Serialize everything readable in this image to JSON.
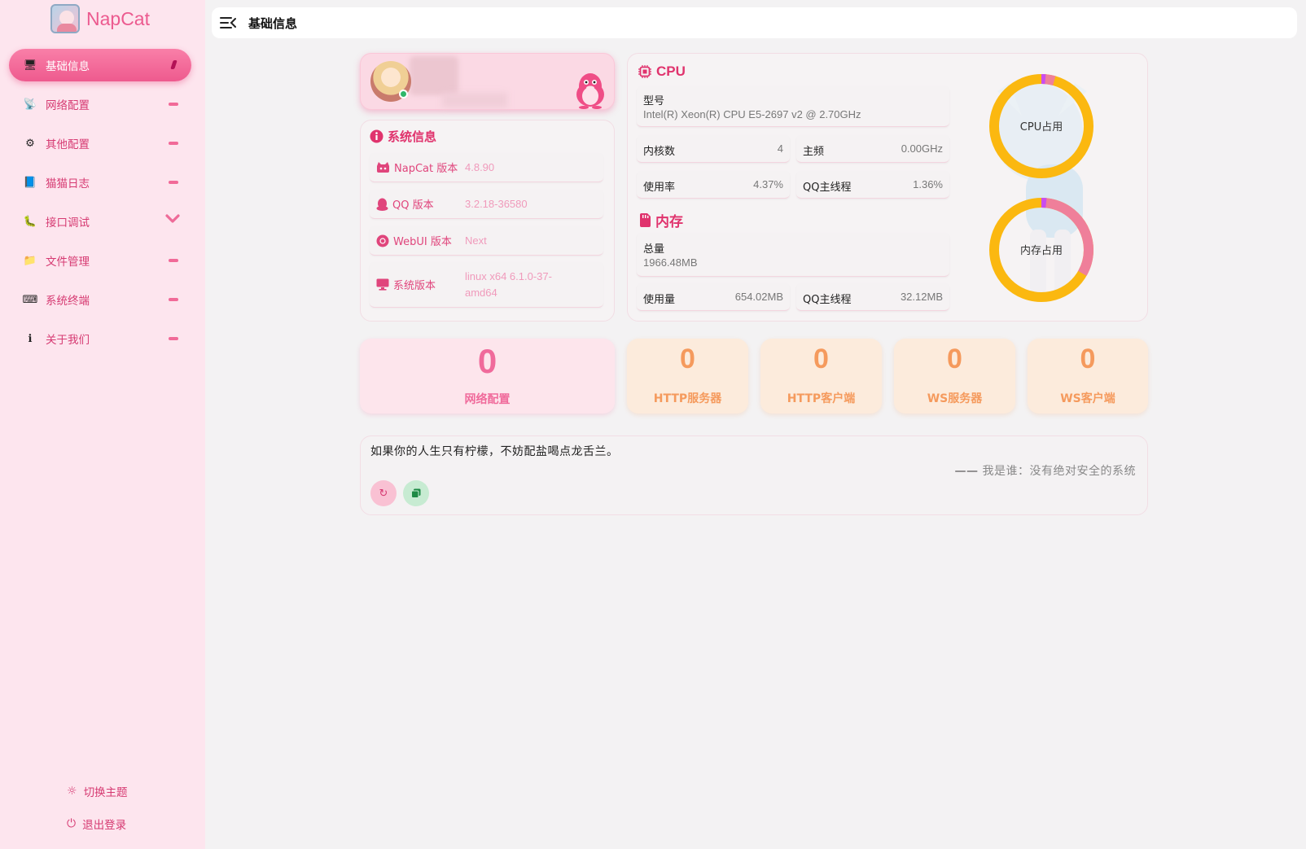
{
  "brand": {
    "name": "NapCat"
  },
  "sidebar": {
    "items": [
      {
        "label": "基础信息",
        "icon": "dashboard-icon",
        "glyph": "🖥",
        "active": true
      },
      {
        "label": "网络配置",
        "icon": "antenna-icon",
        "glyph": "📡"
      },
      {
        "label": "其他配置",
        "icon": "gear-icon",
        "glyph": "⚙"
      },
      {
        "label": "猫猫日志",
        "icon": "notebook-icon",
        "glyph": "📘"
      },
      {
        "label": "接口调试",
        "icon": "bug-icon",
        "glyph": "🐛",
        "expandable": true
      },
      {
        "label": "文件管理",
        "icon": "folder-icon",
        "glyph": "📁"
      },
      {
        "label": "系统终端",
        "icon": "terminal-icon",
        "glyph": "⌨"
      },
      {
        "label": "关于我们",
        "icon": "info-icon",
        "glyph": "ℹ"
      }
    ],
    "theme_label": "切换主题",
    "logout_label": "退出登录"
  },
  "header": {
    "title": "基础信息"
  },
  "system_info": {
    "title": "系统信息",
    "rows": [
      {
        "label": "NapCat 版本",
        "value": "4.8.90",
        "icon": "napcat-icon"
      },
      {
        "label": "QQ 版本",
        "value": "3.2.18-36580",
        "icon": "qq-icon"
      },
      {
        "label": "WebUI 版本",
        "value": "Next",
        "icon": "chrome-icon"
      },
      {
        "label": "系统版本",
        "value": "linux x64 6.1.0-37-amd64",
        "icon": "monitor-icon"
      }
    ]
  },
  "cpu": {
    "title": "CPU",
    "model_label": "型号",
    "model_value": "Intel(R) Xeon(R) CPU E5-2697 v2 @ 2.70GHz",
    "cores_label": "内核数",
    "cores_value": "4",
    "freq_label": "主频",
    "freq_value": "0.00GHz",
    "usage_label": "使用率",
    "usage_value": "4.37%",
    "qq_thread_label": "QQ主线程",
    "qq_thread_value": "1.36%",
    "gauge_label": "CPU占用",
    "usage_fraction": 0.0437,
    "qq_fraction": 0.0136
  },
  "memory": {
    "title": "内存",
    "total_label": "总量",
    "total_value": "1966.48MB",
    "used_label": "使用量",
    "used_value": "654.02MB",
    "qq_thread_label": "QQ主线程",
    "qq_thread_value": "32.12MB",
    "gauge_label": "内存占用",
    "usage_fraction": 0.3326,
    "qq_fraction": 0.0163
  },
  "counters": [
    {
      "value": "0",
      "label": "网络配置",
      "style": "pink"
    },
    {
      "value": "0",
      "label": "HTTP服务器",
      "style": "orange"
    },
    {
      "value": "0",
      "label": "HTTP客户端",
      "style": "orange"
    },
    {
      "value": "0",
      "label": "WS服务器",
      "style": "orange"
    },
    {
      "value": "0",
      "label": "WS客户端",
      "style": "orange"
    }
  ],
  "quote": {
    "text": "如果你的人生只有柠檬，不妨配盐喝点龙舌兰。",
    "dash": "——",
    "author": "我是谁：没有绝对安全的系统"
  },
  "colors": {
    "accent": "#ec5a8f",
    "gauge_free": "#fbb810",
    "gauge_used": "#ef7f9a",
    "gauge_qq": "#c94df0"
  }
}
